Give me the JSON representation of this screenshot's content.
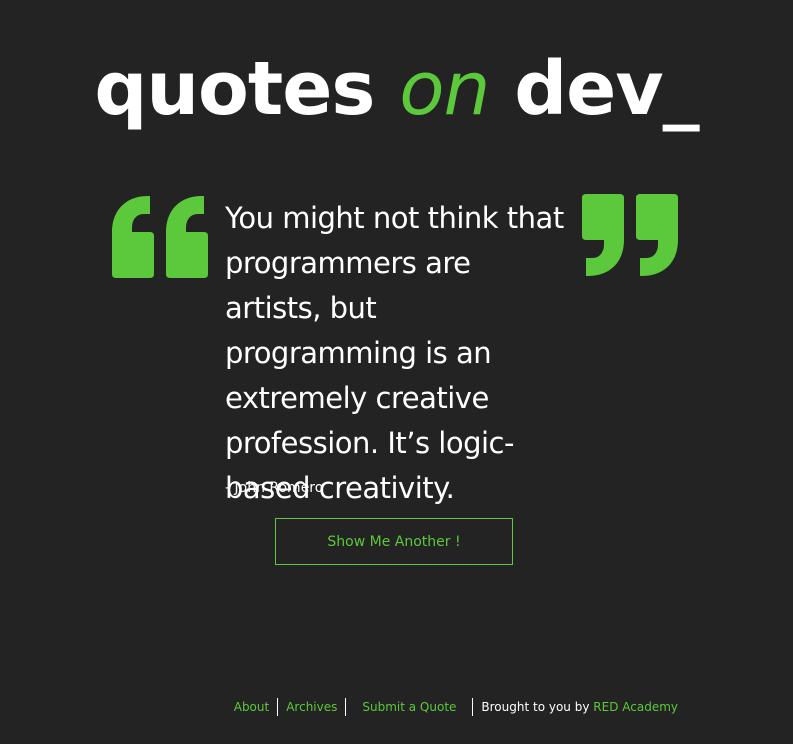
{
  "logo": {
    "word1": "quotes",
    "word2": "on",
    "word3": "dev_"
  },
  "quote": {
    "text": "You might not think that programmers are artists, but programming is an extremely creative profession. It’s logic-based creativity.",
    "author": "- John Romero"
  },
  "button": {
    "label": "Show Me Another !"
  },
  "footer": {
    "about": "About",
    "archives": "Archives",
    "submit": "Submit a Quote",
    "brought_prefix": "Brought to you by",
    "brought_link": "RED Academy"
  },
  "icons": {
    "left": "open-quote-icon",
    "right": "close-quote-icon"
  },
  "colors": {
    "background": "#232323",
    "accent": "#5cc83b",
    "text": "#ffffff"
  }
}
